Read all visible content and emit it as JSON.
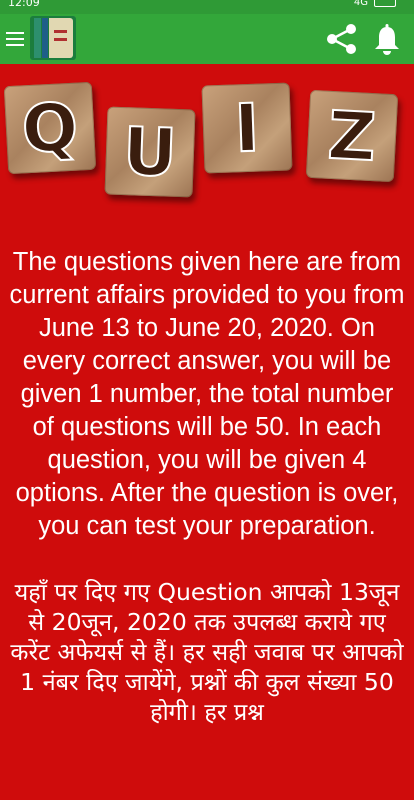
{
  "status_bar": {
    "time": "12:09",
    "network": "4G"
  },
  "toolbar": {
    "app_icon": "books-icon",
    "menu_icon": "hamburger-icon",
    "share_icon": "share-icon",
    "bell_icon": "bell-icon"
  },
  "banner": {
    "letters": [
      "Q",
      "U",
      "I",
      "Z"
    ]
  },
  "content": {
    "english_paragraph": "The questions given here are from current affairs provided to you from June 13 to June 20, 2020. On every correct answer, you will be given 1 number, the total number of questions will be 50. In each question, you will be given 4 options. After the question is over, you can test your preparation.",
    "hindi_paragraph": "यहाँ पर दिए गए Question आपको 13जून से 20जून, 2020 तक उपलब्ध कराये गए करेंट अफेयर्स से हैं। हर सही जवाब पर आपको 1 नंबर दिए जायेंगे, प्रश्नों की कुल संख्या 50 होगी। हर प्रश्न"
  },
  "colors": {
    "toolbar": "#33a73a",
    "background": "#cf0c0c",
    "text": "#ffffff"
  }
}
